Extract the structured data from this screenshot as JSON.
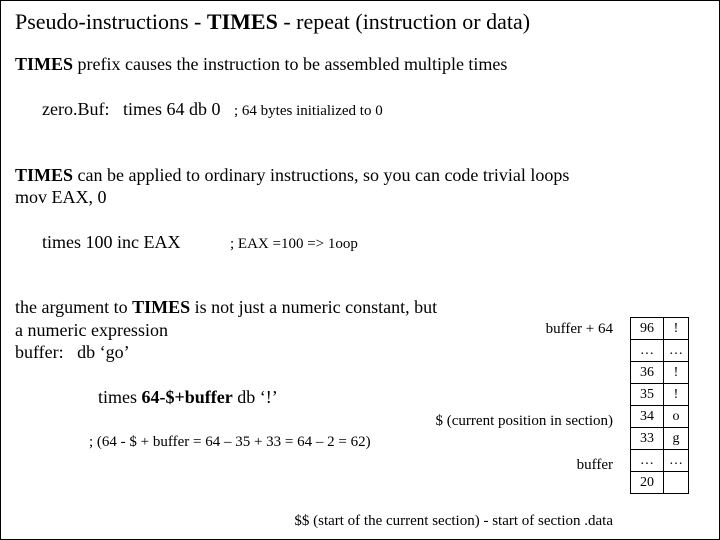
{
  "title": {
    "lead": "Pseudo-instructions - ",
    "keyword": "TIMES",
    "tail": " - repeat (instruction or data)"
  },
  "p1": {
    "line1a": "TIMES",
    "line1b": " prefix causes the instruction to be assembled multiple times",
    "code": "zero.Buf:   times 64 db 0   ",
    "comment": "; 64 bytes initialized to 0"
  },
  "p2": {
    "line1a": "TIMES",
    "line1b": " can be applied to ordinary instructions, so you can code trivial loops",
    "code1": "mov EAX, 0",
    "code2": "times 100 inc EAX           ",
    "comment": "; EAX =100 => 1oop"
  },
  "p3": {
    "line1a": "the argument to ",
    "line1b": "TIMES",
    "line1c": " is not just a numeric constant, but",
    "line2": "a numeric expression",
    "code1": "buffer:   db ‘go’",
    "code2pre": "times ",
    "code2bold": "64-$+buffer",
    "code2post": " db ‘!’",
    "math": "; (64 - $ + buffer = 64 – 35 + 33 = 64 – 2 = 62)"
  },
  "labels": {
    "bufplus64": "buffer + 64",
    "dollar": "$ (current position  in section)",
    "buffer": "buffer",
    "ddollar": "$$ (start of the current section) -  start of section .data"
  },
  "mem": [
    {
      "addr": "96",
      "val": "!"
    },
    {
      "addr": "…",
      "val": "…"
    },
    {
      "addr": "36",
      "val": "!"
    },
    {
      "addr": "35",
      "val": "!"
    },
    {
      "addr": "34",
      "val": "o"
    },
    {
      "addr": "33",
      "val": "g"
    },
    {
      "addr": "…",
      "val": "…"
    },
    {
      "addr": "20",
      "val": ""
    }
  ]
}
